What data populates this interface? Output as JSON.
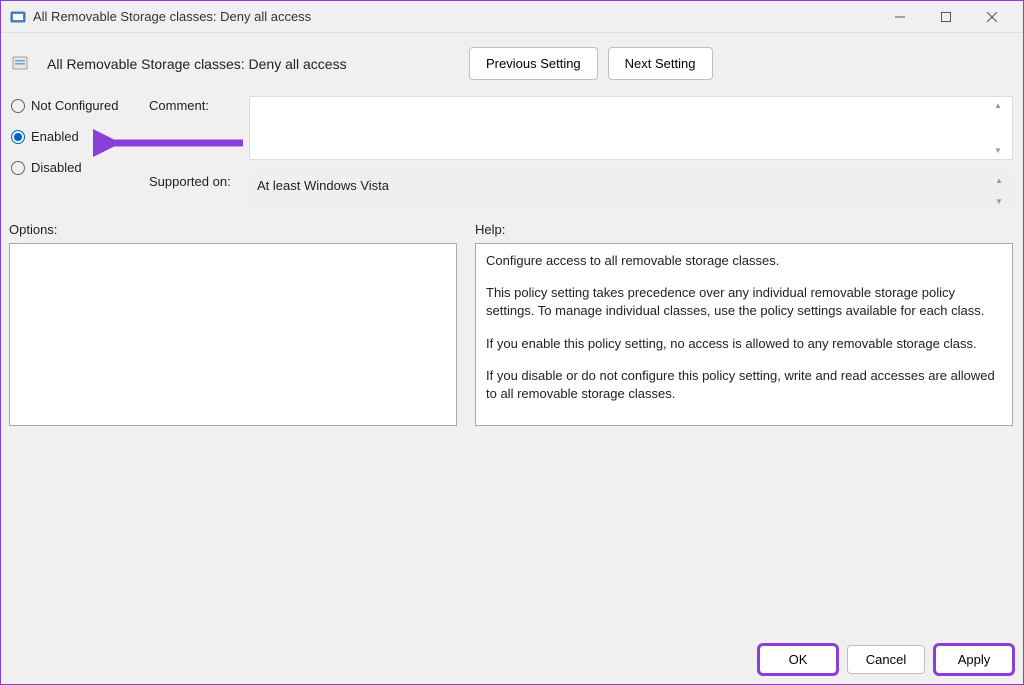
{
  "window": {
    "title": "All Removable Storage classes: Deny all access"
  },
  "header": {
    "title": "All Removable Storage classes: Deny all access",
    "prev_btn": "Previous Setting",
    "next_btn": "Next Setting"
  },
  "radios": {
    "not_configured": "Not Configured",
    "enabled": "Enabled",
    "disabled": "Disabled",
    "selected": "enabled"
  },
  "fields": {
    "comment_label": "Comment:",
    "comment_value": "",
    "supported_label": "Supported on:",
    "supported_value": "At least Windows Vista"
  },
  "sections": {
    "options_label": "Options:",
    "help_label": "Help:"
  },
  "help": {
    "p1": "Configure access to all removable storage classes.",
    "p2": "This policy setting takes precedence over any individual removable storage policy settings. To manage individual classes, use the policy settings available for each class.",
    "p3": "If you enable this policy setting, no access is allowed to any removable storage class.",
    "p4": "If you disable or do not configure this policy setting, write and read accesses are allowed to all removable storage classes."
  },
  "footer": {
    "ok": "OK",
    "cancel": "Cancel",
    "apply": "Apply"
  }
}
